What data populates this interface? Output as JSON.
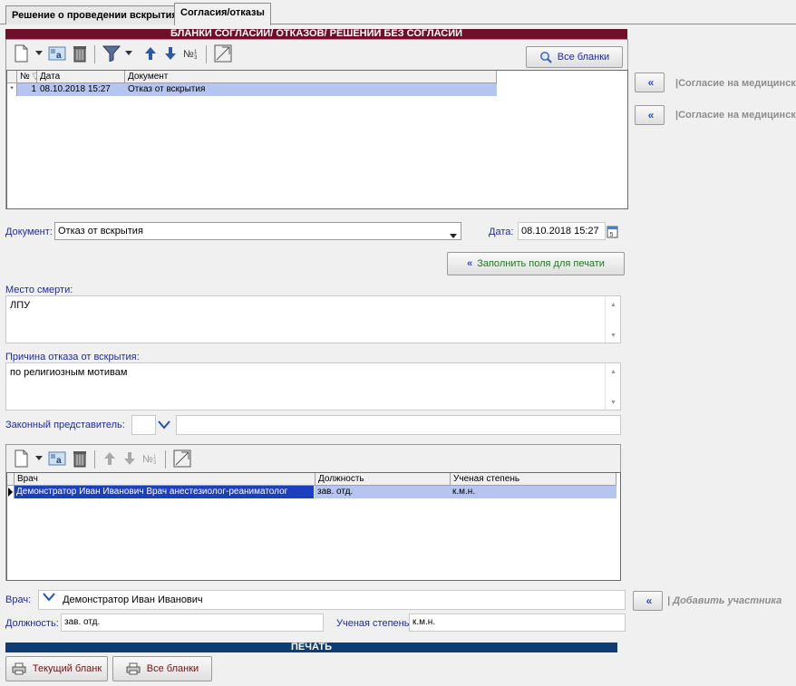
{
  "tabs": [
    {
      "label": "Решение о проведении вскрытия"
    },
    {
      "label": "Согласия/отказы"
    }
  ],
  "consent_section": {
    "header": "БЛАНКИ СОГЛАСИЙ/ ОТКАЗОВ/ РЕШЕНИЙ БЕЗ СОГЛАСИЙ",
    "all_forms_button": "Все бланки",
    "columns": [
      "№",
      "Дата",
      "Документ"
    ],
    "rows": [
      {
        "num": "1",
        "date": "08.10.2018 15:27",
        "doc": "Отказ от вскрытия"
      }
    ]
  },
  "side_buttons": [
    {
      "icon": "double-left-arrow-icon",
      "label": "|Согласие на медицинск"
    },
    {
      "icon": "double-left-arrow-icon",
      "label": "|Согласие на медицинск"
    }
  ],
  "document": {
    "label": "Документ:",
    "value": "Отказ от вскрытия",
    "date_label": "Дата:",
    "date_value": "08.10.2018 15:27"
  },
  "fill_print_button": "Заполнить поля для печати",
  "death_place": {
    "label": "Место смерти:",
    "value": "ЛПУ"
  },
  "refusal_reason": {
    "label": "Причина отказа от вскрытия:",
    "value": "по религиозным мотивам"
  },
  "legal_rep": {
    "label": "Законный представитель:"
  },
  "doctors_table": {
    "columns": [
      "Врач",
      "Должность",
      "Ученая степень"
    ],
    "rows": [
      {
        "doctor": "Демонстратор Иван Иванович Врач анестезиолог-реаниматолог",
        "position": "зав. отд.",
        "degree": "к.м.н."
      }
    ]
  },
  "doctor_field": {
    "label": "Врач:",
    "value": "Демонстратор Иван Иванович"
  },
  "add_participant": "| Добавить участника",
  "position_field": {
    "label": "Должность:",
    "value": "зав. отд."
  },
  "degree_field": {
    "label": "Ученая степень:",
    "value": "к.м.н."
  },
  "print_section": {
    "header": "ПЕЧАТЬ",
    "current_form_button": "Текущий бланк",
    "all_forms_button": "Все бланки"
  },
  "colors": {
    "maroon_header": "#6e0f2c",
    "navy_header": "#0f3d73",
    "selection": "#b6c4f0",
    "label_blue": "#1f2aa3",
    "green_text": "#1b7a1b"
  }
}
